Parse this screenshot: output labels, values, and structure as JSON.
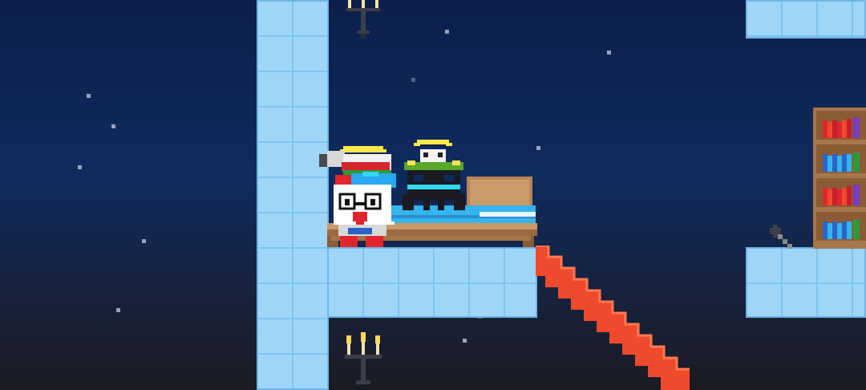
{
  "colors": {
    "sky_top": "#0c1f4a",
    "sky_bottom": "#1b1b22",
    "ice_block": "#9fd6f8",
    "ice_grout": "#7dc3ee",
    "stair_red": "#ef4a2c",
    "bed_wood": "#b8865a",
    "blanket": "#36b4ee",
    "candle_flame": "#ffd85a",
    "bookshelf_wood": "#a7764a"
  },
  "scene": {
    "characters": [
      "angel-cat-player",
      "angel-cat-companion"
    ],
    "objects": [
      "bed",
      "bookshelf",
      "candelabra",
      "candelabra",
      "red-staircase",
      "hammer",
      "ice-wall",
      "ice-platform"
    ]
  }
}
